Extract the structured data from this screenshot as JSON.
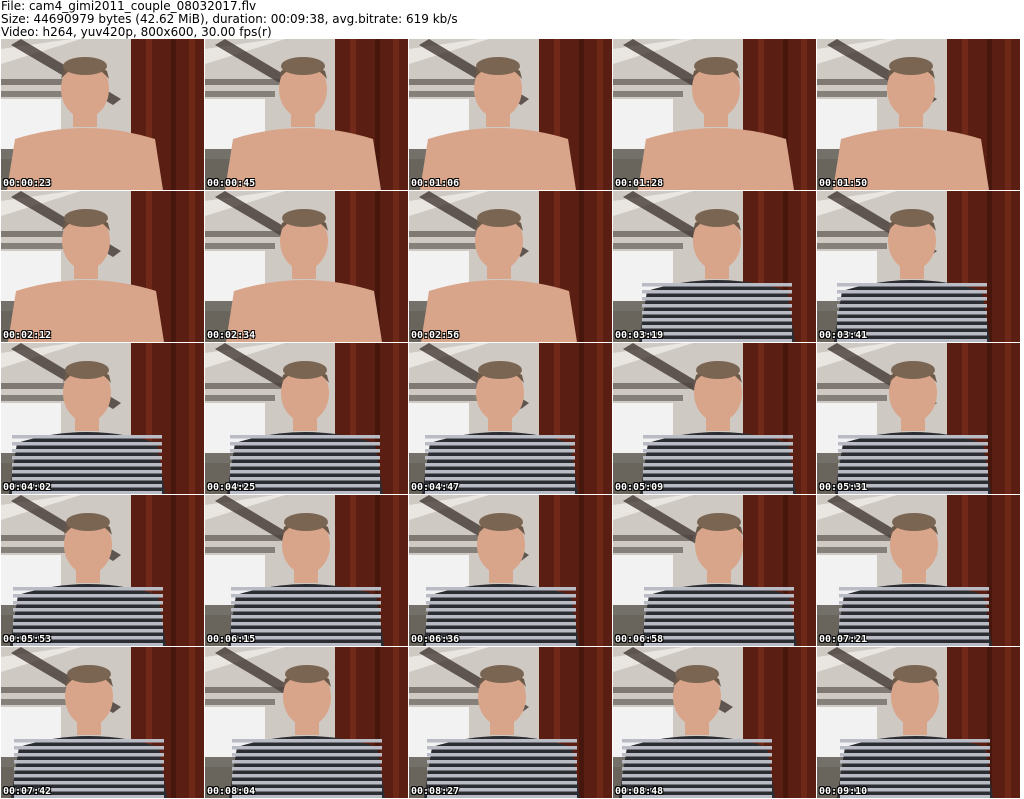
{
  "header": {
    "file_line": "File: cam4_gimi2011_couple_08032017.flv",
    "size_line": "Size: 44690979 bytes (42.62 MiB), duration: 00:09:38, avg.bitrate: 619 kb/s",
    "video_line": "Video: h264, yuv420p, 800x600, 30.00 fps(r)"
  },
  "thumbnails": [
    {
      "timestamp": "00:00:23",
      "shirt": "none"
    },
    {
      "timestamp": "00:00:45",
      "shirt": "none"
    },
    {
      "timestamp": "00:01:06",
      "shirt": "none"
    },
    {
      "timestamp": "00:01:28",
      "shirt": "none"
    },
    {
      "timestamp": "00:01:50",
      "shirt": "none"
    },
    {
      "timestamp": "00:02:12",
      "shirt": "none"
    },
    {
      "timestamp": "00:02:34",
      "shirt": "none"
    },
    {
      "timestamp": "00:02:56",
      "shirt": "none"
    },
    {
      "timestamp": "00:03:19",
      "shirt": "striped"
    },
    {
      "timestamp": "00:03:41",
      "shirt": "striped"
    },
    {
      "timestamp": "00:04:02",
      "shirt": "striped"
    },
    {
      "timestamp": "00:04:25",
      "shirt": "striped"
    },
    {
      "timestamp": "00:04:47",
      "shirt": "striped"
    },
    {
      "timestamp": "00:05:09",
      "shirt": "striped"
    },
    {
      "timestamp": "00:05:31",
      "shirt": "striped"
    },
    {
      "timestamp": "00:05:53",
      "shirt": "striped"
    },
    {
      "timestamp": "00:06:15",
      "shirt": "striped"
    },
    {
      "timestamp": "00:06:36",
      "shirt": "striped"
    },
    {
      "timestamp": "00:06:58",
      "shirt": "striped"
    },
    {
      "timestamp": "00:07:21",
      "shirt": "striped"
    },
    {
      "timestamp": "00:07:42",
      "shirt": "striped"
    },
    {
      "timestamp": "00:08:04",
      "shirt": "striped"
    },
    {
      "timestamp": "00:08:27",
      "shirt": "striped"
    },
    {
      "timestamp": "00:08:48",
      "shirt": "striped"
    },
    {
      "timestamp": "00:09:10",
      "shirt": "striped"
    }
  ],
  "colors": {
    "background": "#ffffff",
    "wall": "#cfc9c3",
    "curtain": "#5a1f12",
    "skin": "#d9a58a",
    "stripe_dark": "#2b2d33",
    "stripe_light": "#b9bcc4",
    "bed": "#f2f2f2"
  }
}
